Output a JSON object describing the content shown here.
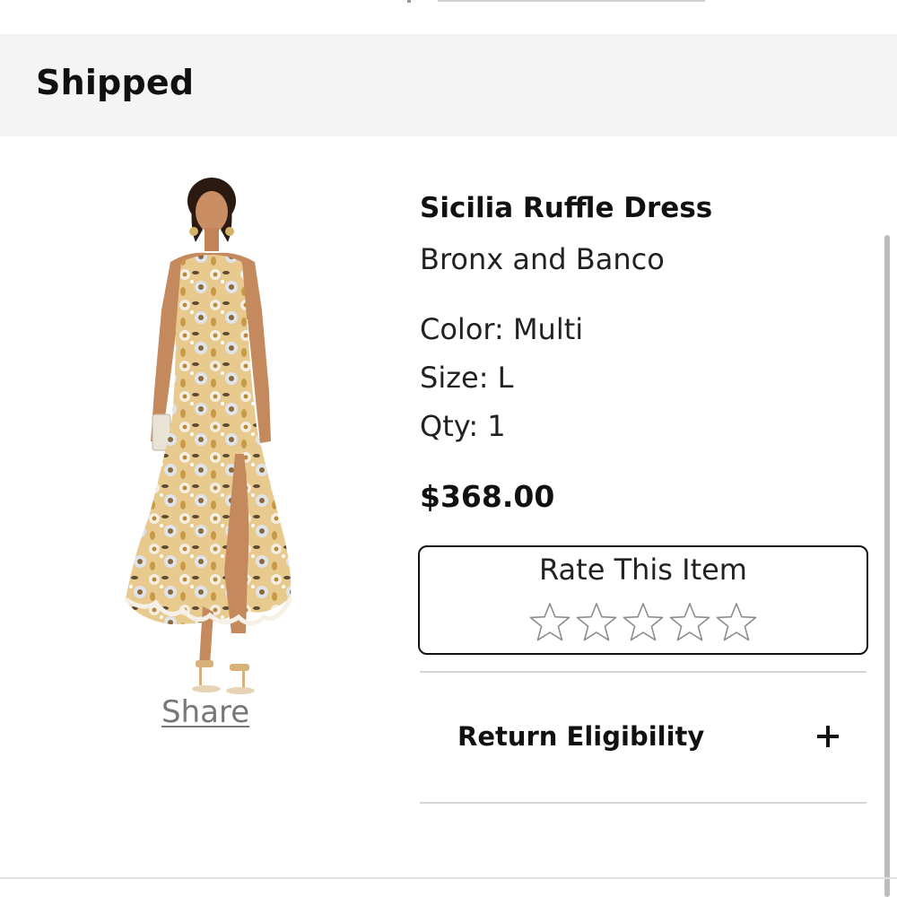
{
  "order_status": {
    "title": "Shipped"
  },
  "product": {
    "name": "Sicilia Ruffle Dress",
    "brand": "Bronx and Banco",
    "color": "Color: Multi",
    "size": "Size: L",
    "qty": "Qty: 1",
    "price": "$368.00",
    "share_label": "Share"
  },
  "rating": {
    "title": "Rate This Item",
    "max_stars": 5,
    "current": 0
  },
  "return_eligibility": {
    "label": "Return Eligibility",
    "expanded": false
  },
  "icons": {
    "star": "star-outline-icon",
    "expand": "plus-icon"
  }
}
